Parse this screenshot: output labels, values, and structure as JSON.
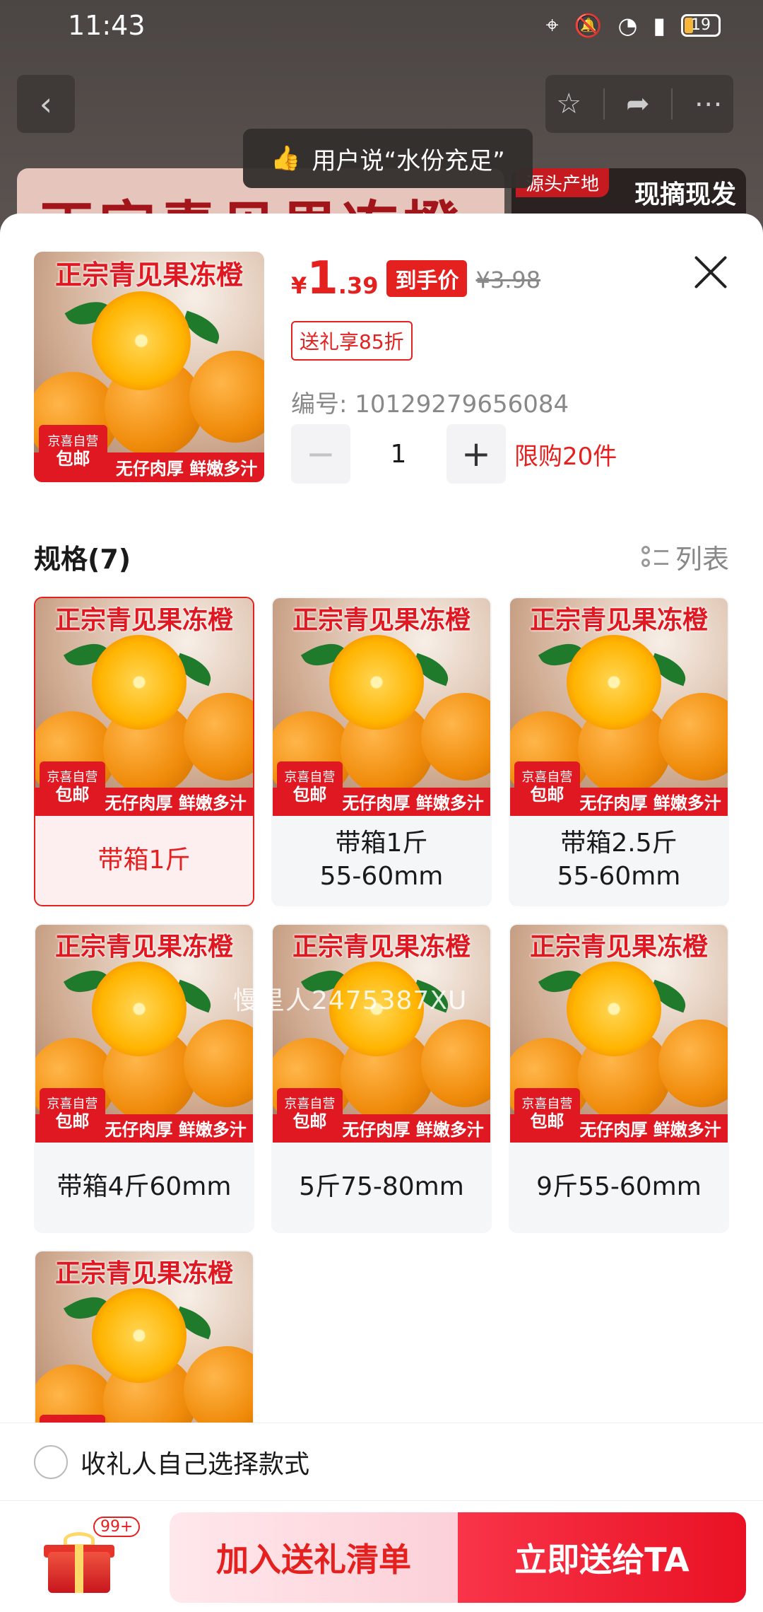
{
  "status_bar": {
    "time": "11:43",
    "battery": "19"
  },
  "background": {
    "review_text": "用户说“水份充足”",
    "hero_title": "正宗青见果冻橙",
    "hero_tag": "源头产地",
    "hero_right_text": "现摘现发"
  },
  "product": {
    "image": {
      "title": "正宗青见果冻橙",
      "mark_small": "京喜自营",
      "mark_big": "包邮",
      "banner": "无仔肉厚 鲜嫩多汁"
    },
    "price": {
      "currency": "¥",
      "integer": "1",
      "decimal": ".39",
      "tag": "到手价",
      "original": "¥3.98"
    },
    "gift_discount": "送礼享85折",
    "sku_number": "编号: 10129279656084",
    "quantity": "1",
    "minus": "−",
    "plus": "+",
    "limit": "限购20件"
  },
  "specs": {
    "title": "规格(7)",
    "view_toggle": "列表",
    "items": [
      {
        "label": "带箱1斤",
        "selected": true
      },
      {
        "label": "带箱1斤\n55-60mm",
        "selected": false
      },
      {
        "label": "带箱2.5斤\n55-60mm",
        "selected": false
      },
      {
        "label": "带箱4斤60mm",
        "selected": false
      },
      {
        "label": "5斤75-80mm",
        "selected": false
      },
      {
        "label": "9斤55-60mm",
        "selected": false
      },
      {
        "label": "",
        "selected": false
      }
    ]
  },
  "watermark": "慢星人2475387XU",
  "receiver": {
    "text": "收礼人自己选择款式"
  },
  "actions": {
    "badge": "99+",
    "add_to_list": "加入送礼清单",
    "send_now": "立即送给TA"
  },
  "colors": {
    "accent": "#e4211f",
    "send_button": "#f01b2e"
  }
}
